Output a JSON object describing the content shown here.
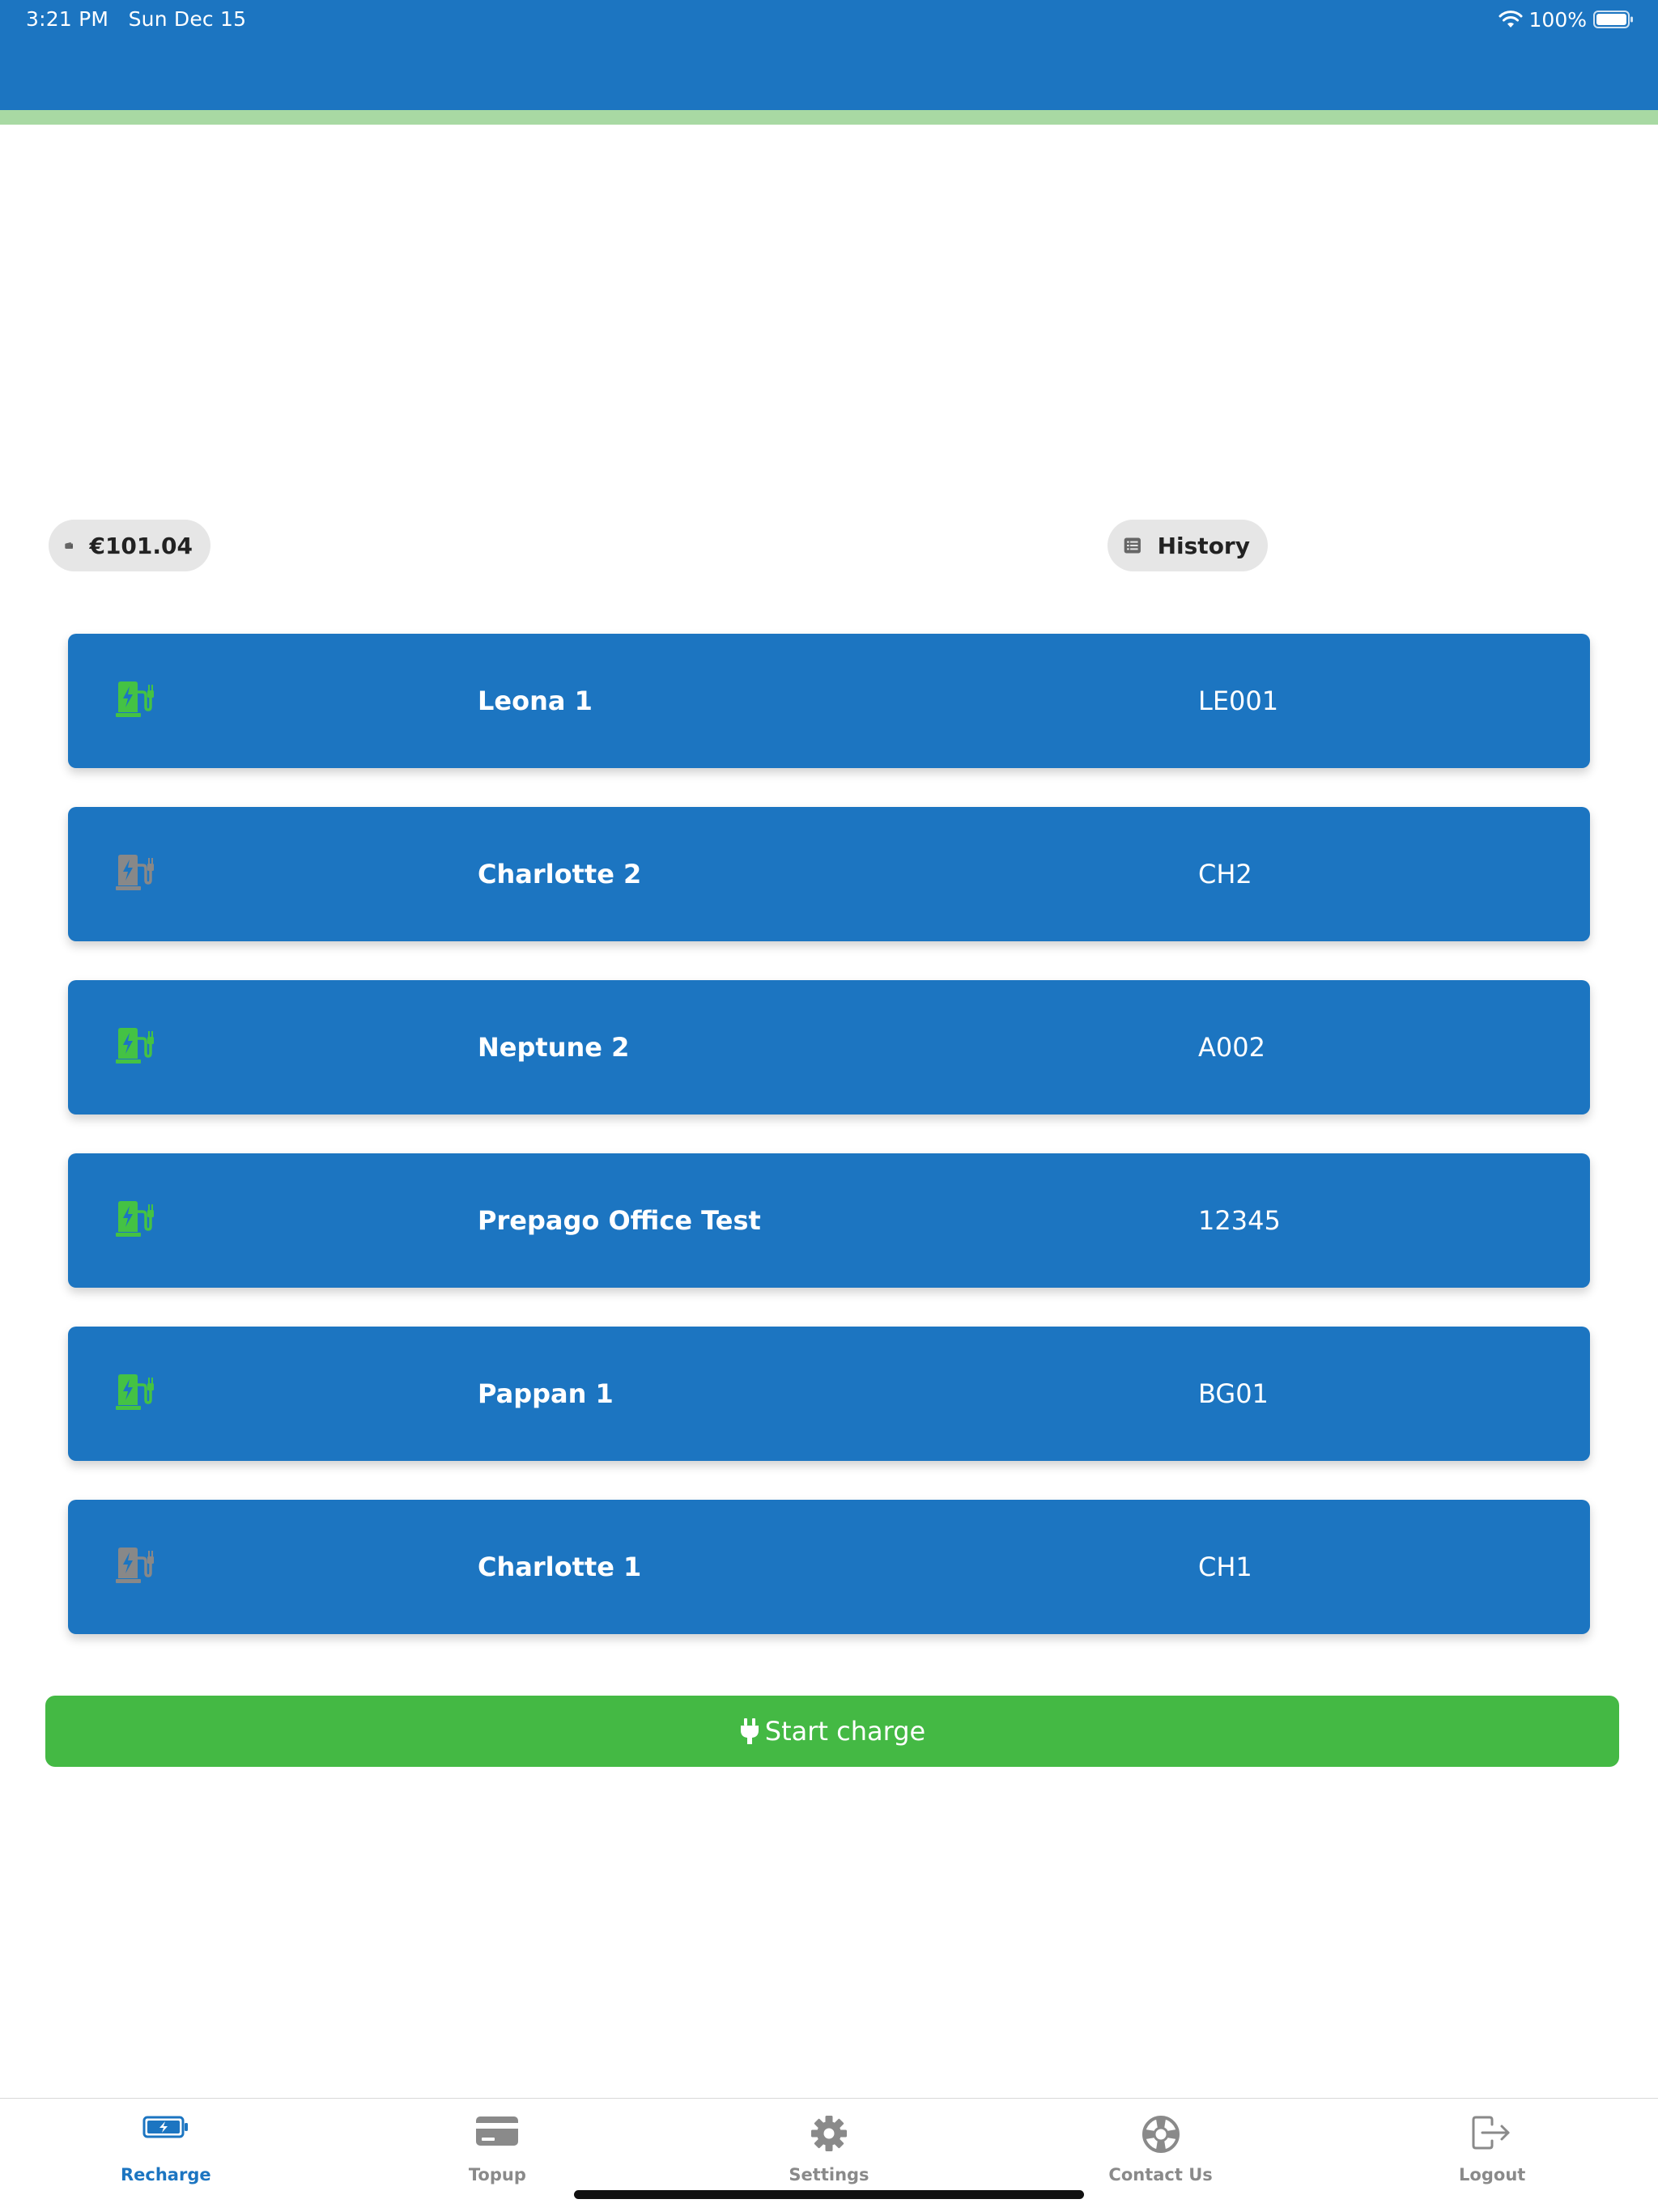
{
  "status_bar": {
    "time": "3:21 PM",
    "date": "Sun Dec 15",
    "battery_percent": "100%",
    "battery_level": 1.0
  },
  "colors": {
    "header_blue": "#1c75c1",
    "header_strip_green": "#a8d9a3",
    "available_icon_green": "#44c244",
    "unavailable_icon_gray": "#888888",
    "start_button_green": "#44b944",
    "pill_gray": "#e6e6e6"
  },
  "wallet": {
    "balance": "€101.04",
    "icon": "wallet-icon"
  },
  "history_button": {
    "label": "History",
    "icon": "list-icon"
  },
  "chargers": [
    {
      "name": "Leona 1",
      "code": "LE001",
      "status": "available",
      "icon": "ev-charger-icon"
    },
    {
      "name": "Charlotte 2",
      "code": "CH2",
      "status": "unavailable",
      "icon": "ev-charger-icon"
    },
    {
      "name": "Neptune 2",
      "code": "A002",
      "status": "available",
      "icon": "ev-charger-icon"
    },
    {
      "name": "Prepago Office Test",
      "code": "12345",
      "status": "available",
      "icon": "ev-charger-icon"
    },
    {
      "name": "Pappan 1",
      "code": "BG01",
      "status": "available",
      "icon": "ev-charger-icon"
    },
    {
      "name": "Charlotte 1",
      "code": "CH1",
      "status": "unavailable",
      "icon": "ev-charger-icon"
    }
  ],
  "start_charge": {
    "label": "Start charge",
    "icon": "plug-icon"
  },
  "tabs": [
    {
      "label": "Recharge",
      "icon": "battery-icon",
      "active": true
    },
    {
      "label": "Topup",
      "icon": "credit-card-icon",
      "active": false
    },
    {
      "label": "Settings",
      "icon": "gear-icon",
      "active": false
    },
    {
      "label": "Contact Us",
      "icon": "lifebuoy-icon",
      "active": false
    },
    {
      "label": "Logout",
      "icon": "logout-icon",
      "active": false
    }
  ]
}
